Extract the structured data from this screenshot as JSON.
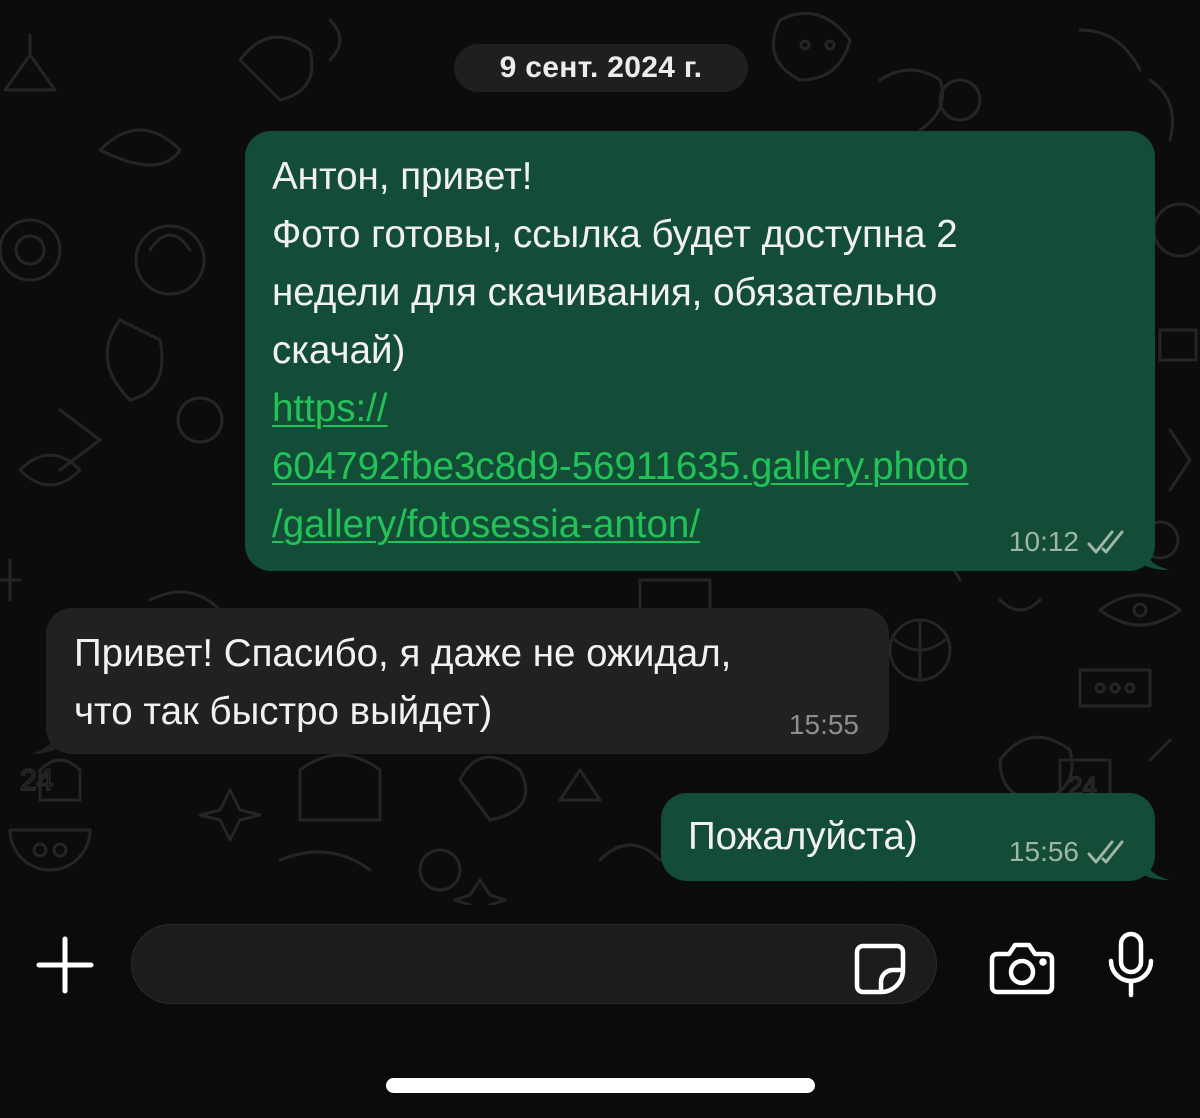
{
  "chat": {
    "date_separator": "9 сент. 2024 г.",
    "messages": [
      {
        "direction": "outgoing",
        "lines": [
          "Антон, привет!",
          "Фото готовы, ссылка будет доступна 2",
          "недели для скачивания, обязательно",
          "скачай)"
        ],
        "link_lines": [
          "https://",
          "604792fbe3c8d9-56911635.gallery.photo",
          "/gallery/fotosessia-anton/"
        ],
        "time": "10:12",
        "status": "read"
      },
      {
        "direction": "incoming",
        "lines": [
          "Привет! Спасибо, я даже не ожидал,",
          "что так быстро выйдет)"
        ],
        "time": "15:55"
      },
      {
        "direction": "outgoing",
        "lines": [
          "Пожалуйста)"
        ],
        "time": "15:56",
        "status": "read"
      }
    ]
  },
  "composer": {
    "input_value": "",
    "icons": [
      "plus-icon",
      "sticker-icon",
      "camera-icon",
      "microphone-icon"
    ]
  },
  "colors": {
    "outgoing_bubble": "#144d37",
    "incoming_bubble": "#202222",
    "link": "#23c258",
    "background": "#0b0b0b"
  }
}
